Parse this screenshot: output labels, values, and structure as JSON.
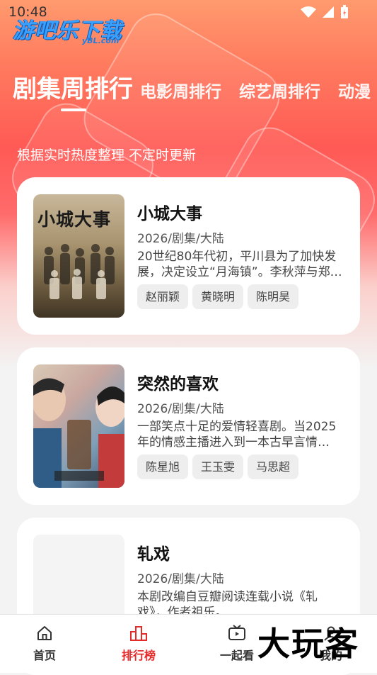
{
  "status": {
    "time": "10:48"
  },
  "logo": {
    "main": "游吧乐下载",
    "sub": "yBL.com"
  },
  "tabs": [
    {
      "label": "剧集周排行",
      "active": true
    },
    {
      "label": "电影周排行",
      "active": false
    },
    {
      "label": "综艺周排行",
      "active": false
    },
    {
      "label": "动漫",
      "active": false
    }
  ],
  "subtitle": "根据实时热度整理 不定时更新",
  "cards": [
    {
      "title": "小城大事",
      "meta": "2026/剧集/大陆",
      "desc": "20世纪80年代初，平川县为了加快发展，决定设立“月海镇”。李秋萍与郑…",
      "tags": [
        "赵丽颖",
        "黄晓明",
        "陈明昊"
      ],
      "poster_text": "小城大事"
    },
    {
      "title": "突然的喜欢",
      "meta": "2026/剧集/大陆",
      "desc": "一部笑点十足的爱情轻喜剧。当2025年的情感主播进入到一本古早言情…",
      "tags": [
        "陈星旭",
        "王玉雯",
        "马思超"
      ]
    },
    {
      "title": "轧戏",
      "meta": "2026/剧集/大陆",
      "desc": "本剧改编自豆瓣阅读连载小说《轧戏》，作者祖乐。",
      "tags": []
    }
  ],
  "tabbar": [
    {
      "label": "首页",
      "icon": "home-icon",
      "active": false
    },
    {
      "label": "排行榜",
      "icon": "rank-icon",
      "active": true
    },
    {
      "label": "一起看",
      "icon": "tv-icon",
      "active": false
    },
    {
      "label": "我的",
      "icon": "user-icon",
      "active": false
    }
  ],
  "watermark": "大玩客",
  "colors": {
    "accent": "#e52a2a",
    "logo": "#3aa0ff"
  }
}
